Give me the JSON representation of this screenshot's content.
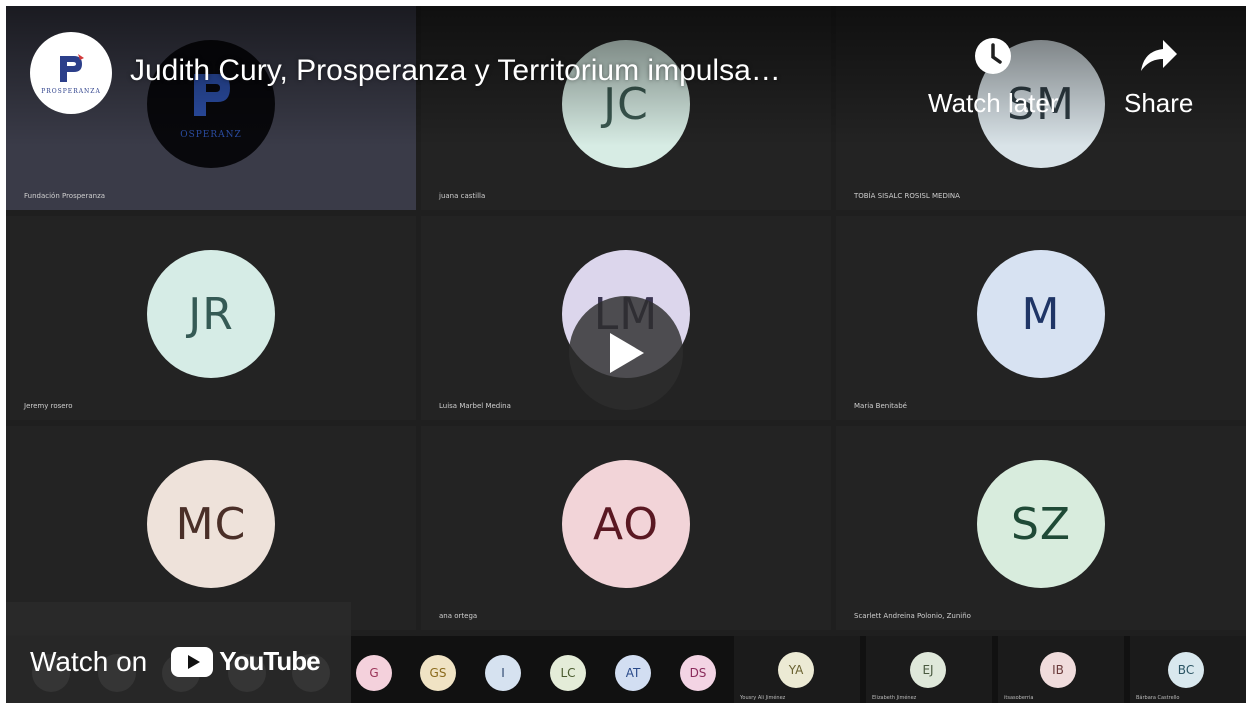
{
  "player": {
    "title": "Judith Cury, Prosperanza y Territorium impulsa…",
    "channel_logo_text": "PROSPERANZA",
    "watch_later_label": "Watch later",
    "share_label": "Share",
    "watch_on_label": "Watch on",
    "youtube_label": "YouTube",
    "icons": [
      "clock-icon",
      "share-arrow-icon",
      "play-icon",
      "youtube-logo-icon"
    ]
  },
  "tiles": [
    {
      "initials": "",
      "name": "Fundación Prosperanza",
      "logo_text": "OSPERANZ",
      "bg": "#3a3b48",
      "fg": "#2c4fa8"
    },
    {
      "initials": "JC",
      "name": "juana castilla",
      "bg": "#d7ece4",
      "fg": "#3c5a52"
    },
    {
      "initials": "SM",
      "name": "TOBÍA SISALC ROSISL MEDINA",
      "bg": "#d9e3e8",
      "fg": "#2f3d44"
    },
    {
      "initials": "JR",
      "name": "Jeremy rosero",
      "bg": "#d6ece6",
      "fg": "#355a55"
    },
    {
      "initials": "LM",
      "name": "Luisa Marbel Medina",
      "bg": "#dcd6ec",
      "fg": "#3a3550"
    },
    {
      "initials": "M",
      "name": "Maria Benitabé",
      "bg": "#d7e2f2",
      "fg": "#1f3566"
    },
    {
      "initials": "MC",
      "name": "",
      "bg": "#eee2da",
      "fg": "#4a2f28"
    },
    {
      "initials": "AO",
      "name": "ana ortega",
      "bg": "#f2d4d8",
      "fg": "#5a1822"
    },
    {
      "initials": "SZ",
      "name": "Scarlett Andreina Polonio, Zuniño",
      "bg": "#d8ecdd",
      "fg": "#1f4a36"
    }
  ],
  "strip_avatars": [
    {
      "initials": "G",
      "bg": "#f4d1dc",
      "fg": "#9a3458"
    },
    {
      "initials": "GS",
      "bg": "#f0e3c4",
      "fg": "#8a6a1c"
    },
    {
      "initials": "I",
      "bg": "#d6e2f0",
      "fg": "#2f4a70"
    },
    {
      "initials": "LC",
      "bg": "#e4ecd8",
      "fg": "#4a5a2e"
    },
    {
      "initials": "AT",
      "bg": "#d2def2",
      "fg": "#2a4a8a"
    },
    {
      "initials": "DS",
      "bg": "#f3d4e4",
      "fg": "#8a2c5c"
    }
  ],
  "strip_tiles": [
    {
      "initials": "YA",
      "name": "Yousry Ali Jiménez",
      "bg": "#ecead4",
      "fg": "#6a6230"
    },
    {
      "initials": "EJ",
      "name": "Elizabeth Jiménez",
      "bg": "#dfe8da",
      "fg": "#4a5a40"
    },
    {
      "initials": "IB",
      "name": "itsasoberria",
      "bg": "#f0dcdc",
      "fg": "#6a3a3a"
    },
    {
      "initials": "BC",
      "name": "Bárbara Castrello",
      "bg": "#d9e8ee",
      "fg": "#2c5564"
    }
  ]
}
